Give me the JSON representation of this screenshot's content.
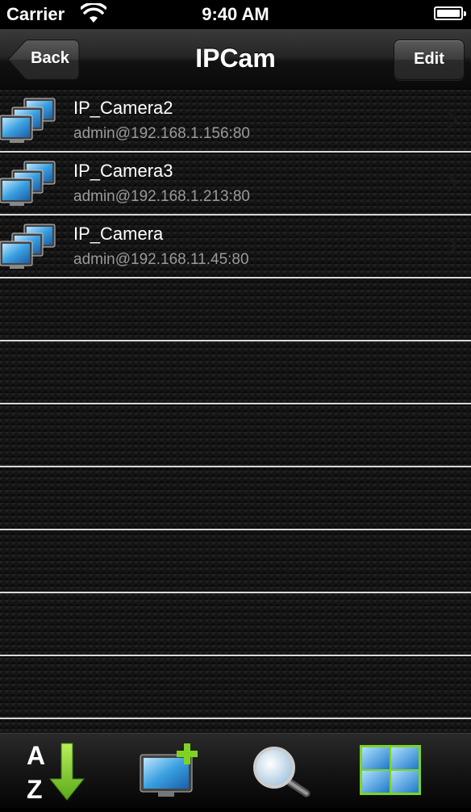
{
  "status_bar": {
    "carrier": "Carrier",
    "time": "9:40 AM"
  },
  "nav": {
    "title": "IPCam",
    "back_label": "Back",
    "edit_label": "Edit"
  },
  "cameras": [
    {
      "name": "IP_Camera2",
      "address": "admin@192.168.1.156:80"
    },
    {
      "name": "IP_Camera3",
      "address": "admin@192.168.1.213:80"
    },
    {
      "name": "IP_Camera",
      "address": "admin@192.168.11.45:80"
    }
  ],
  "toolbar": {
    "items": [
      "sort-az-icon",
      "add-camera-icon",
      "search-icon",
      "grid-view-icon"
    ]
  },
  "colors": {
    "accent_green": "#7ed321",
    "icon_blue": "#3aa0e0",
    "separator": "#d8d8d8"
  }
}
